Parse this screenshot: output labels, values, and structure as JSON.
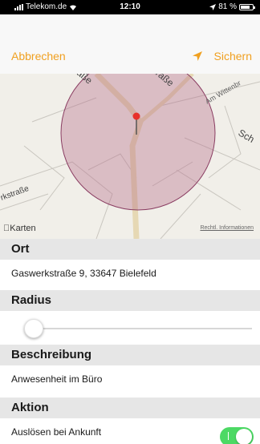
{
  "status_bar": {
    "carrier": "Telekom.de",
    "time": "12:10",
    "battery": "81 %",
    "battery_level": 0.81
  },
  "nav": {
    "cancel_label": "Abbrechen",
    "save_label": "Sichern",
    "location_icon": "location-arrow-icon",
    "accent_color": "#f0a020"
  },
  "map": {
    "street_labels": [
      "aße",
      "straße",
      "Am Wittenbr",
      "Sch",
      "rkstraße"
    ],
    "logo": "Karten",
    "legal": "Rechtl. Informationen",
    "region_color": "#b56b8a"
  },
  "sections": {
    "location": {
      "header": "Ort",
      "value": "Gaswerkstraße 9, 33647 Bielefeld"
    },
    "radius": {
      "header": "Radius",
      "slider_value": 0.0
    },
    "description": {
      "header": "Beschreibung",
      "value": "Anwesenheit im Büro"
    },
    "action": {
      "header": "Aktion",
      "value": "Auslösen bei Ankunft",
      "toggle_on": true,
      "toggle_color": "#4cd964"
    }
  }
}
